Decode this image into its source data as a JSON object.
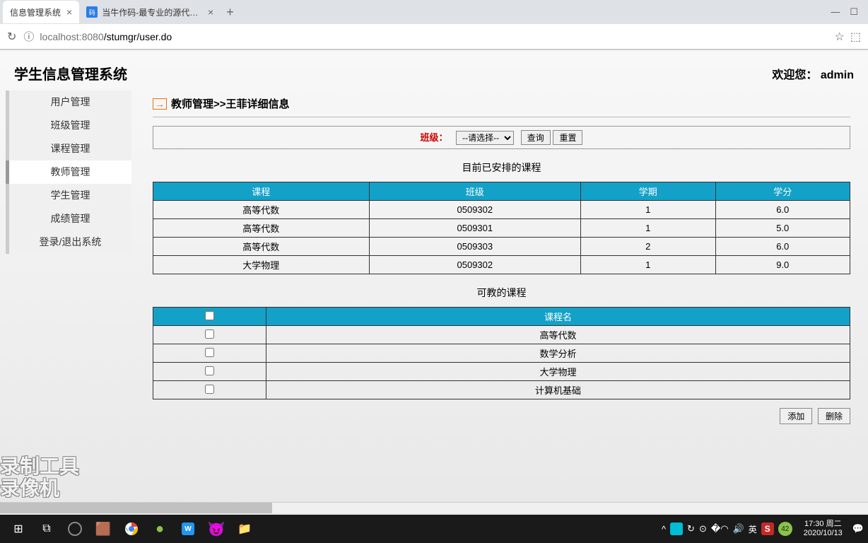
{
  "browser": {
    "tabs": [
      {
        "title": "信息管理系统",
        "active": true
      },
      {
        "title": "当牛作码-最专业的源代码分享网",
        "active": false
      }
    ],
    "url_host": "localhost:8080",
    "url_path": "/stumgr/user.do"
  },
  "app": {
    "title": "学生信息管理系统",
    "welcome_prefix": "欢迎您：",
    "welcome_user": "admin"
  },
  "sidebar": {
    "items": [
      {
        "label": "用户管理",
        "active": false
      },
      {
        "label": "班级管理",
        "active": false
      },
      {
        "label": "课程管理",
        "active": false
      },
      {
        "label": "教师管理",
        "active": true
      },
      {
        "label": "学生管理",
        "active": false
      },
      {
        "label": "成绩管理",
        "active": false
      },
      {
        "label": "登录/退出系统",
        "active": false
      }
    ]
  },
  "breadcrumb": "教师管理>>王菲详细信息",
  "filter": {
    "label": "班级：",
    "select_placeholder": "--请选择--",
    "query_btn": "查询",
    "reset_btn": "重置"
  },
  "scheduled": {
    "title": "目前已安排的课程",
    "headers": [
      "课程",
      "班级",
      "学期",
      "学分"
    ],
    "rows": [
      [
        "高等代数",
        "0509302",
        "1",
        "6.0"
      ],
      [
        "高等代数",
        "0509301",
        "1",
        "5.0"
      ],
      [
        "高等代数",
        "0509303",
        "2",
        "6.0"
      ],
      [
        "大学物理",
        "0509302",
        "1",
        "9.0"
      ]
    ]
  },
  "teachable": {
    "title": "可教的课程",
    "header_name": "课程名",
    "rows": [
      "高等代数",
      "数学分析",
      "大学物理",
      "计算机基础"
    ]
  },
  "actions": {
    "add": "添加",
    "delete": "删除"
  },
  "taskbar": {
    "time": "17:30",
    "day": "周二",
    "date": "2020/10/13",
    "ime": "英",
    "badge": "42"
  },
  "watermark": {
    "line1": "录制工具",
    "line2": "录像机"
  }
}
